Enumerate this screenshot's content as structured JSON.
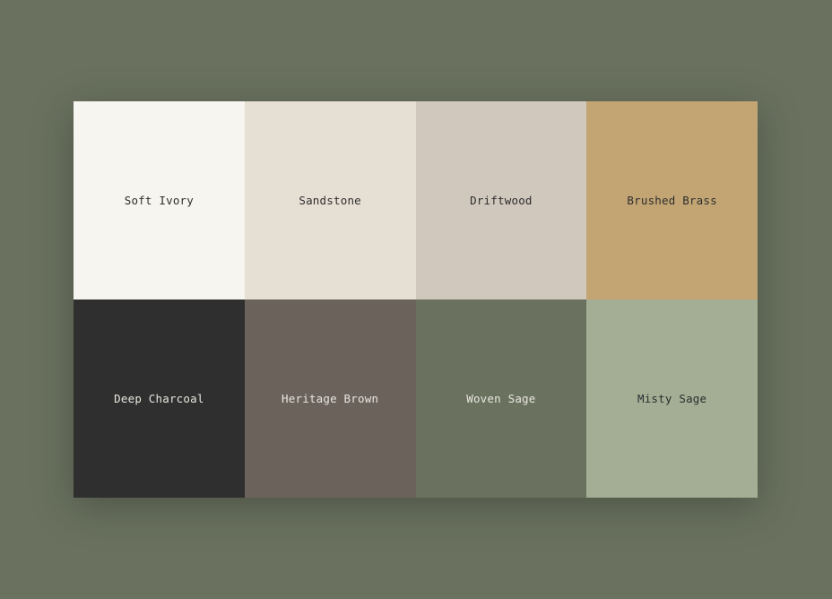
{
  "swatches": [
    {
      "name": "Soft Ivory",
      "color": "#f7f5ef",
      "text_color": "#2e2e2e"
    },
    {
      "name": "Sandstone",
      "color": "#e6dfd4",
      "text_color": "#2e2e2e"
    },
    {
      "name": "Driftwood",
      "color": "#d0c7bd",
      "text_color": "#2e2e2e"
    },
    {
      "name": "Brushed Brass",
      "color": "#c3a574",
      "text_color": "#2e2e2e"
    },
    {
      "name": "Deep Charcoal",
      "color": "#2f2f2f",
      "text_color": "#e9e6df"
    },
    {
      "name": "Heritage Brown",
      "color": "#6b625c",
      "text_color": "#e9e6df"
    },
    {
      "name": "Woven Sage",
      "color": "#6a725f",
      "text_color": "#e9e6df"
    },
    {
      "name": "Misty Sage",
      "color": "#a3ae95",
      "text_color": "#2e2e2e"
    }
  ]
}
